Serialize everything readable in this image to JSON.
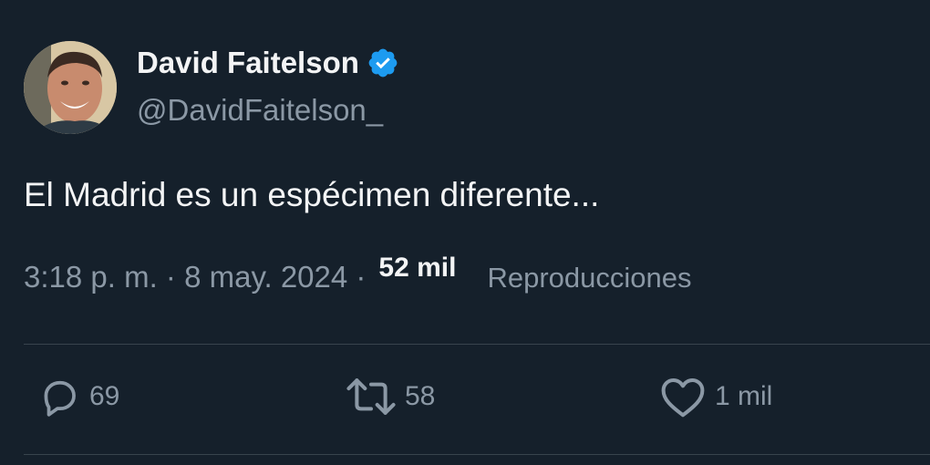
{
  "author": {
    "name": "David Faitelson",
    "handle": "@DavidFaitelson_",
    "verified": true
  },
  "tweet": {
    "text": "El Madrid es un espécimen diferente..."
  },
  "meta": {
    "time": "3:18 p. m.",
    "date": "8 may. 2024",
    "views_count": "52 mil",
    "views_label": "Reproducciones"
  },
  "actions": {
    "replies": "69",
    "retweets": "58",
    "likes": "1 mil"
  },
  "colors": {
    "background": "#15202b",
    "verified": "#1d9bf0",
    "secondary_text": "#8b98a5"
  }
}
